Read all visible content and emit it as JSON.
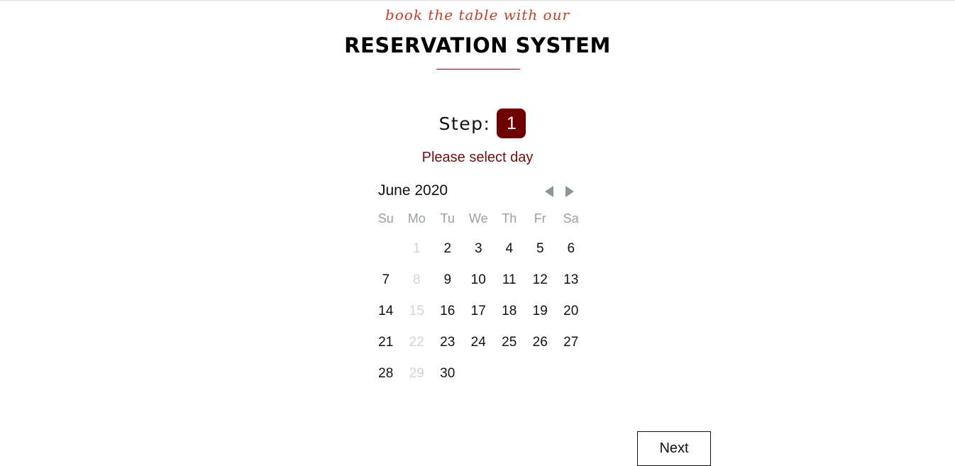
{
  "header": {
    "tagline": "book the table with our",
    "title": "RESERVATION SYSTEM"
  },
  "step": {
    "label": "Step:",
    "number": "1"
  },
  "instruction": "Please select day",
  "calendar": {
    "month_label": "June 2020",
    "prev_icon": "triangle-left-icon",
    "next_icon": "triangle-right-icon",
    "weekdays": [
      "Su",
      "Mo",
      "Tu",
      "We",
      "Th",
      "Fr",
      "Sa"
    ],
    "weeks": [
      [
        {
          "label": "",
          "disabled": false
        },
        {
          "label": "1",
          "disabled": true
        },
        {
          "label": "2",
          "disabled": false
        },
        {
          "label": "3",
          "disabled": false
        },
        {
          "label": "4",
          "disabled": false
        },
        {
          "label": "5",
          "disabled": false
        },
        {
          "label": "6",
          "disabled": false
        }
      ],
      [
        {
          "label": "7",
          "disabled": false
        },
        {
          "label": "8",
          "disabled": true
        },
        {
          "label": "9",
          "disabled": false
        },
        {
          "label": "10",
          "disabled": false
        },
        {
          "label": "11",
          "disabled": false
        },
        {
          "label": "12",
          "disabled": false
        },
        {
          "label": "13",
          "disabled": false
        }
      ],
      [
        {
          "label": "14",
          "disabled": false
        },
        {
          "label": "15",
          "disabled": true
        },
        {
          "label": "16",
          "disabled": false
        },
        {
          "label": "17",
          "disabled": false
        },
        {
          "label": "18",
          "disabled": false
        },
        {
          "label": "19",
          "disabled": false
        },
        {
          "label": "20",
          "disabled": false
        }
      ],
      [
        {
          "label": "21",
          "disabled": false
        },
        {
          "label": "22",
          "disabled": true
        },
        {
          "label": "23",
          "disabled": false
        },
        {
          "label": "24",
          "disabled": false
        },
        {
          "label": "25",
          "disabled": false
        },
        {
          "label": "26",
          "disabled": false
        },
        {
          "label": "27",
          "disabled": false
        }
      ],
      [
        {
          "label": "28",
          "disabled": false
        },
        {
          "label": "29",
          "disabled": true
        },
        {
          "label": "30",
          "disabled": false
        },
        {
          "label": "",
          "disabled": false
        },
        {
          "label": "",
          "disabled": false
        },
        {
          "label": "",
          "disabled": false
        },
        {
          "label": "",
          "disabled": false
        }
      ]
    ]
  },
  "next_button": "Next",
  "colors": {
    "accent": "#6e0000",
    "tagline": "#c0402b",
    "instruction": "#6e1010",
    "nav_arrow": "#8a9697",
    "weekday": "#95a0a5",
    "disabled_day": "#d4d4d4"
  }
}
